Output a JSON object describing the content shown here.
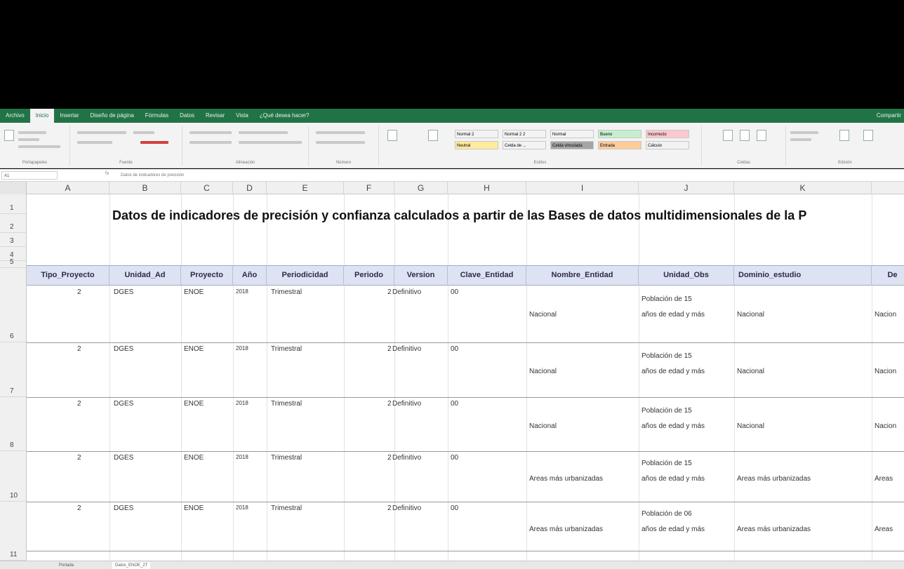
{
  "ribbon": {
    "tabs": [
      "Archivo",
      "Inicio",
      "Insertar",
      "Diseño de página",
      "Fórmulas",
      "Datos",
      "Revisar",
      "Vista",
      "¿Qué desea hacer?"
    ],
    "right_label": "Compartir",
    "groups": [
      "Portapapeles",
      "Fuente",
      "Alineación",
      "Número",
      "Estilos",
      "Celdas",
      "Edición"
    ],
    "styles": [
      "Normal 2",
      "Normal 2 2",
      "Normal",
      "Bueno",
      "Incorrecto",
      "Neutral",
      "Celda de ...",
      "Celda vinculada",
      "Entrada",
      "Cálculo"
    ],
    "style_colors": [
      "#ffffff",
      "#ffffff",
      "#ffffff",
      "#c6efce",
      "#ffc7ce",
      "#ffeb9c",
      "#a5a5a5",
      "#ffffff",
      "#ffcc99",
      "#f2f2f2"
    ]
  },
  "formula_bar": {
    "name_box": "A1",
    "fx": "fx",
    "content": "Datos de indicadores de precisión"
  },
  "grid": {
    "columns": [
      "A",
      "B",
      "C",
      "D",
      "E",
      "F",
      "G",
      "H",
      "I",
      "J",
      "K"
    ],
    "rows": [
      "1",
      "2",
      "3",
      "4",
      "5",
      "6",
      "7",
      "8",
      "10",
      "11"
    ],
    "title": "Datos de indicadores de precisión y confianza calculados a partir de las Bases de datos multidimensionales de la P",
    "headers": [
      "Tipo_Proyecto",
      "Unidad_Ad",
      "Proyecto",
      "Año",
      "Periodicidad",
      "Periodo",
      "Version",
      "Clave_Entidad",
      "Nombre_Entidad",
      "Unidad_Obs",
      "Dominio_estudio",
      "De"
    ],
    "data_rows": [
      {
        "row": "6",
        "tipo": "2",
        "unidad": "DGES",
        "proyecto": "ENOE",
        "anio": "2018",
        "periodicidad": "Trimestral",
        "periodo": "2",
        "version": "Definitivo",
        "clave": "00",
        "nombre": "Nacional",
        "obs1": "Población de 15",
        "obs2": "años de edad y más",
        "dominio": "Nacional",
        "de": "Nacion"
      },
      {
        "row": "7",
        "tipo": "2",
        "unidad": "DGES",
        "proyecto": "ENOE",
        "anio": "2018",
        "periodicidad": "Trimestral",
        "periodo": "2",
        "version": "Definitivo",
        "clave": "00",
        "nombre": "Nacional",
        "obs1": "Población de 15",
        "obs2": "años de edad y más",
        "dominio": "Nacional",
        "de": "Nacion"
      },
      {
        "row": "8",
        "tipo": "2",
        "unidad": "DGES",
        "proyecto": "ENOE",
        "anio": "2018",
        "periodicidad": "Trimestral",
        "periodo": "2",
        "version": "Definitivo",
        "clave": "00",
        "nombre": "Nacional",
        "obs1": "Población de 15",
        "obs2": "años de edad y más",
        "dominio": "Nacional",
        "de": "Nacion"
      },
      {
        "row": "10",
        "tipo": "2",
        "unidad": "DGES",
        "proyecto": "ENOE",
        "anio": "2018",
        "periodicidad": "Trimestral",
        "periodo": "2",
        "version": "Definitivo",
        "clave": "00",
        "nombre": "Áreas más urbanizadas",
        "obs1": "Población de 15",
        "obs2": "años de edad y más",
        "dominio": "Áreas más urbanizadas",
        "de": "Áreas"
      },
      {
        "row": "11",
        "tipo": "2",
        "unidad": "DGES",
        "proyecto": "ENOE",
        "anio": "2018",
        "periodicidad": "Trimestral",
        "periodo": "2",
        "version": "Definitivo",
        "clave": "00",
        "nombre": "Áreas más urbanizadas",
        "obs1": "Población de 06",
        "obs2": "años de edad y más",
        "dominio": "Áreas más urbanizadas",
        "de": "Áreas"
      }
    ]
  },
  "sheet_tabs": [
    "Portada",
    "Datos_ENOE_2T"
  ]
}
